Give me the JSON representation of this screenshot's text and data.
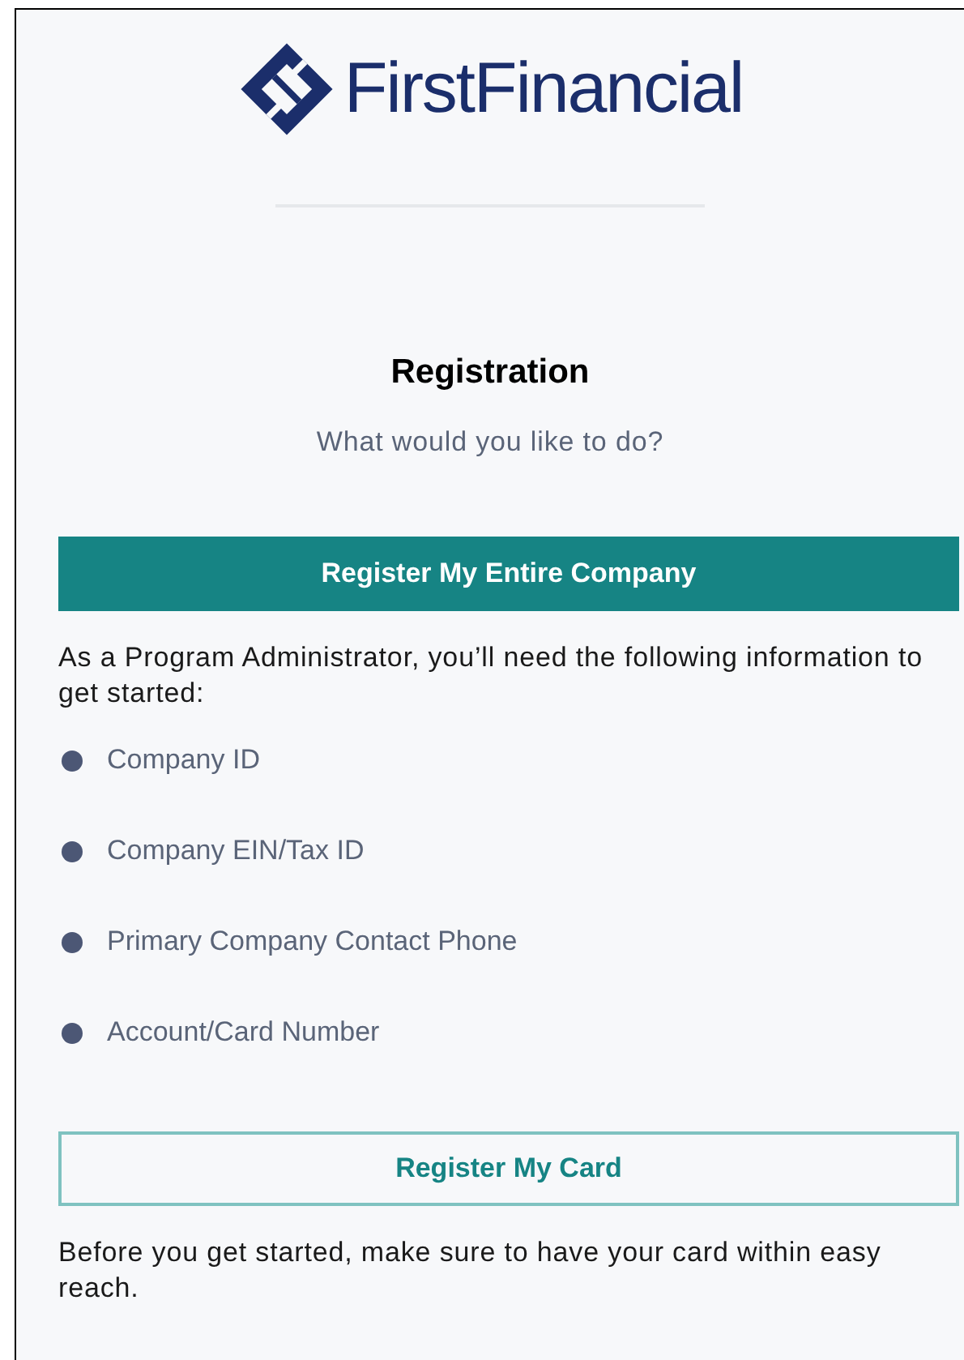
{
  "logo": {
    "text": "**First**Financial"
  },
  "title": "Registration",
  "subtitle": "What would you like to do?",
  "options": [
    {
      "kind": "primary",
      "button": "Register My Entire Company",
      "description": "As a Program Administrator, you’ll need the following information to get started:",
      "items": [
        "Company ID",
        "Company EIN/Tax ID",
        "Primary Company Contact Phone",
        "Account/Card Number"
      ]
    },
    {
      "kind": "outline",
      "button": "Register My Card",
      "description": "Before you get started, make sure to have your card within easy reach."
    }
  ]
}
